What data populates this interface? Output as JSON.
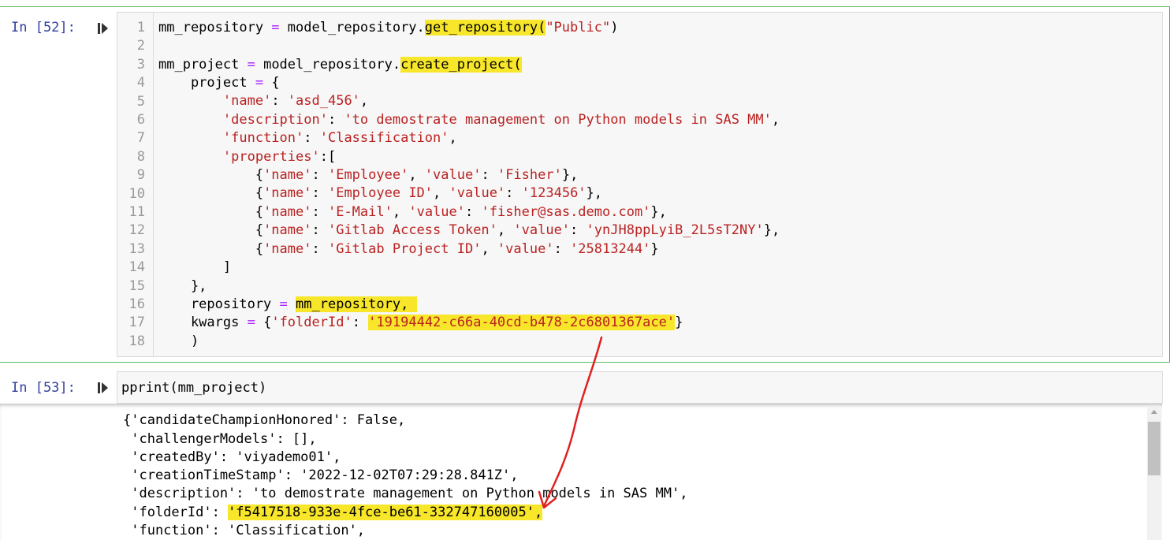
{
  "cells": [
    {
      "prompt": "In [52]:",
      "line_numbers": [
        "1",
        "2",
        "3",
        "4",
        "5",
        "6",
        "7",
        "8",
        "9",
        "10",
        "11",
        "12",
        "13",
        "14",
        "15",
        "16",
        "17",
        "18"
      ],
      "code": {
        "l1_a": "mm_repository ",
        "l1_op": "=",
        "l1_b": " model_repository.",
        "l1_hl": "get_repository(",
        "l1_str": "\"Public\"",
        "l1_c": ")",
        "l3_a": "mm_project ",
        "l3_op": "=",
        "l3_b": " model_repository.",
        "l3_hl": "create_project(",
        "l4_a": "    project ",
        "l4_op": "=",
        "l4_b": " {",
        "l5_a": "        ",
        "l5_k": "'name'",
        "l5_b": ": ",
        "l5_v": "'asd_456'",
        "l5_c": ",",
        "l6_a": "        ",
        "l6_k": "'description'",
        "l6_b": ": ",
        "l6_v": "'to demostrate management on Python models in SAS MM'",
        "l6_c": ",",
        "l7_a": "        ",
        "l7_k": "'function'",
        "l7_b": ": ",
        "l7_v": "'Classification'",
        "l7_c": ",",
        "l8_a": "        ",
        "l8_k": "'properties'",
        "l8_b": ":[",
        "l9_a": "            {",
        "l9_k1": "'name'",
        "l9_b": ": ",
        "l9_v1": "'Employee'",
        "l9_c": ", ",
        "l9_k2": "'value'",
        "l9_d": ": ",
        "l9_v2": "'Fisher'",
        "l9_e": "},",
        "l10_a": "            {",
        "l10_k1": "'name'",
        "l10_b": ": ",
        "l10_v1": "'Employee ID'",
        "l10_c": ", ",
        "l10_k2": "'value'",
        "l10_d": ": ",
        "l10_v2": "'123456'",
        "l10_e": "},",
        "l11_a": "            {",
        "l11_k1": "'name'",
        "l11_b": ": ",
        "l11_v1": "'E-Mail'",
        "l11_c": ", ",
        "l11_k2": "'value'",
        "l11_d": ": ",
        "l11_v2": "'fisher@sas.demo.com'",
        "l11_e": "},",
        "l12_a": "            {",
        "l12_k1": "'name'",
        "l12_b": ": ",
        "l12_v1": "'Gitlab Access Token'",
        "l12_c": ", ",
        "l12_k2": "'value'",
        "l12_d": ": ",
        "l12_v2": "'ynJH8ppLyiB_2L5sT2NY'",
        "l12_e": "},",
        "l13_a": "            {",
        "l13_k1": "'name'",
        "l13_b": ": ",
        "l13_v1": "'Gitlab Project ID'",
        "l13_c": ", ",
        "l13_k2": "'value'",
        "l13_d": ": ",
        "l13_v2": "'25813244'",
        "l13_e": "}",
        "l14": "        ]",
        "l15": "    },",
        "l16_a": "    repository ",
        "l16_op": "=",
        "l16_b": " ",
        "l16_hl": "mm_repository, ",
        "l17_a": "    kwargs ",
        "l17_op": "=",
        "l17_b": " {",
        "l17_k": "'folderId'",
        "l17_c": ": ",
        "l17_hl": "'19194442-c66a-40cd-b478-2c6801367ace'",
        "l17_d": "}",
        "l18": "    )"
      }
    },
    {
      "prompt": "In [53]:",
      "code": "pprint(mm_project)"
    }
  ],
  "output": {
    "lines": [
      "{'candidateChampionHonored': False,",
      " 'challengerModels': [],",
      " 'createdBy': 'viyademo01',",
      " 'creationTimeStamp': '2022-12-02T07:29:28.841Z',",
      " 'description': 'to demostrate management on Python models in SAS MM',"
    ],
    "folder_prefix": " 'folderId': ",
    "folder_value": "'f5417518-933e-4fce-be61-332747160005',",
    "last_line": " 'function': 'Classification',"
  },
  "colors": {
    "highlight": "#f7e62a",
    "string": "#ba2121",
    "operator": "#aa22ff",
    "prompt": "#303f9f",
    "arrow": "#e02020",
    "cell_border": "#5cb85c"
  },
  "icons": {
    "run": "run-cell-icon",
    "scroll_up": "scroll-up-arrow-icon"
  }
}
